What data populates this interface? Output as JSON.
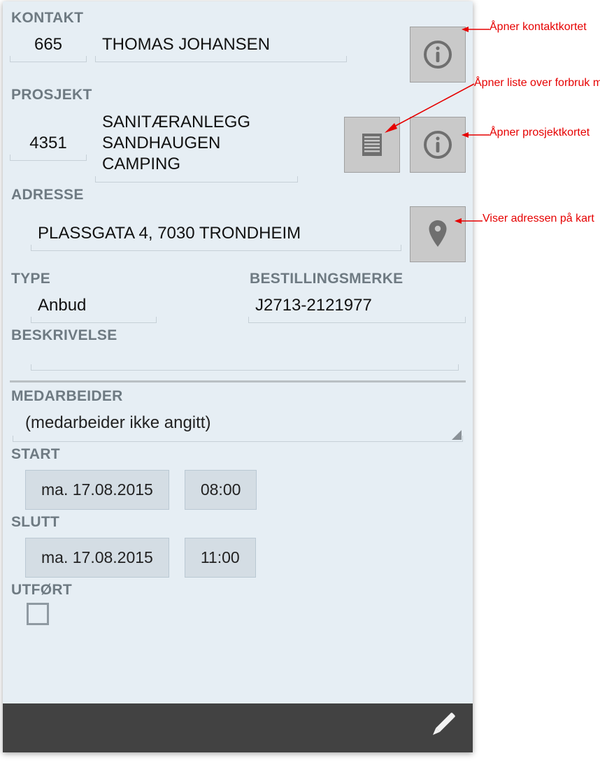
{
  "labels": {
    "kontakt": "KONTAKT",
    "prosjekt": "PROSJEKT",
    "adresse": "ADRESSE",
    "type": "TYPE",
    "bestillingsmerke": "BESTILLINGSMERKE",
    "beskrivelse": "BESKRIVELSE",
    "medarbeider": "MEDARBEIDER",
    "start": "START",
    "slutt": "SLUTT",
    "utfort": "UTFØRT"
  },
  "kontakt": {
    "id": "665",
    "name": "THOMAS JOHANSEN"
  },
  "prosjekt": {
    "id": "4351",
    "name": "SANITÆRANLEGG SANDHAUGEN CAMPING"
  },
  "adresse": {
    "value": "PLASSGATA 4, 7030 TRONDHEIM"
  },
  "type": {
    "value": "Anbud"
  },
  "bestillingsmerke": {
    "value": "J2713-2121977"
  },
  "beskrivelse": {
    "value": ""
  },
  "medarbeider": {
    "selected": "(medarbeider ikke angitt)"
  },
  "start": {
    "date": "ma. 17.08.2015",
    "time": "08:00"
  },
  "slutt": {
    "date": "ma. 17.08.2015",
    "time": "11:00"
  },
  "callouts": {
    "kontakt_info": "Åpner kontaktkortet",
    "prosjekt_list": "Åpner liste over forbruk mv",
    "prosjekt_info": "Åpner prosjektkortet",
    "adresse_map": "Viser adressen på kart"
  }
}
